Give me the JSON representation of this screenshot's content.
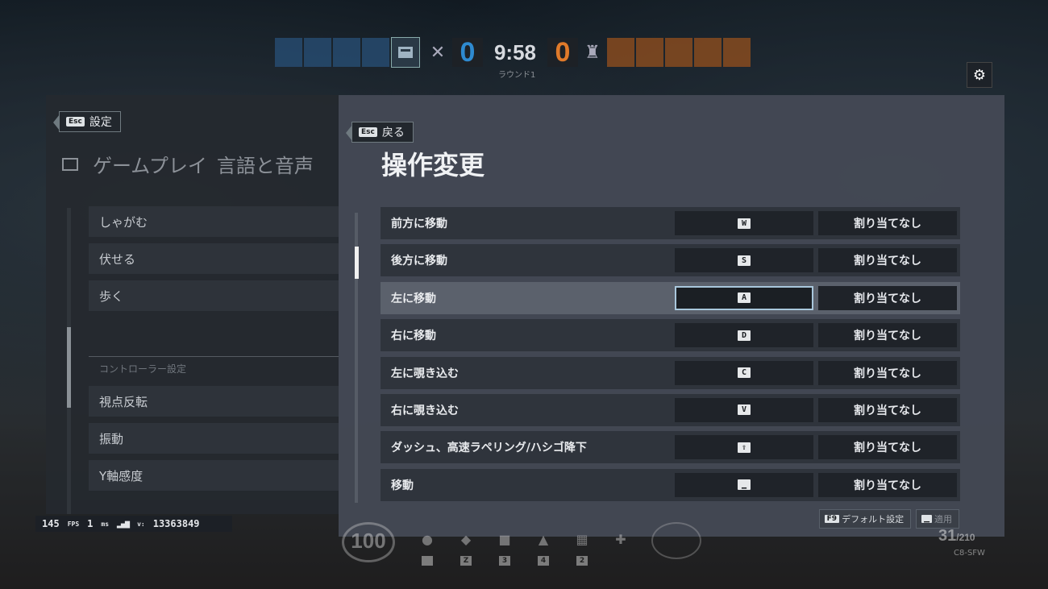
{
  "hud": {
    "blue_score": "0",
    "orange_score": "0",
    "timer": "9:58",
    "round_label": "ラウンド1",
    "health": "100",
    "ammo": "31",
    "ammo_reserve": "/210",
    "weapon": "C8-SFW",
    "gadget_keys": [
      "",
      "Z",
      "3",
      "4",
      "2",
      ""
    ],
    "colors": {
      "blue": "#2e8ad0",
      "orange": "#e07a2a"
    }
  },
  "left_panel": {
    "back_key": "Esc",
    "back_label": "設定",
    "tabs": [
      "ゲームプレイ",
      "言語と音声"
    ],
    "items": [
      "しゃがむ",
      "伏せる",
      "歩く"
    ],
    "section_label": "コントローラー設定",
    "controller_items": [
      "視点反転",
      "振動",
      "Y軸感度"
    ]
  },
  "main_panel": {
    "back_key": "Esc",
    "back_label": "戻る",
    "title": "操作変更",
    "rows": [
      {
        "action": "前方に移動",
        "primary_key": "W",
        "secondary": "割り当てなし"
      },
      {
        "action": "後方に移動",
        "primary_key": "S",
        "secondary": "割り当てなし"
      },
      {
        "action": "左に移動",
        "primary_key": "A",
        "secondary": "割り当てなし"
      },
      {
        "action": "右に移動",
        "primary_key": "D",
        "secondary": "割り当てなし"
      },
      {
        "action": "左に覗き込む",
        "primary_key": "C",
        "secondary": "割り当てなし"
      },
      {
        "action": "右に覗き込む",
        "primary_key": "V",
        "secondary": "割り当てなし"
      },
      {
        "action": "ダッシュ、高速ラペリング/ハシゴ降下",
        "primary_key": "⇧",
        "secondary": "割り当てなし"
      },
      {
        "action": "移動",
        "primary_key": "▁",
        "secondary": "割り当てなし"
      }
    ],
    "footer": {
      "default_key": "F9",
      "default_label": "デフォルト設定",
      "apply_key": "▁",
      "apply_label": "適用"
    }
  },
  "stats": {
    "fps": "145",
    "fps_unit": "FPS",
    "ping": "1",
    "ping_unit": "ms",
    "version_label": "v:",
    "version": "13363849"
  }
}
